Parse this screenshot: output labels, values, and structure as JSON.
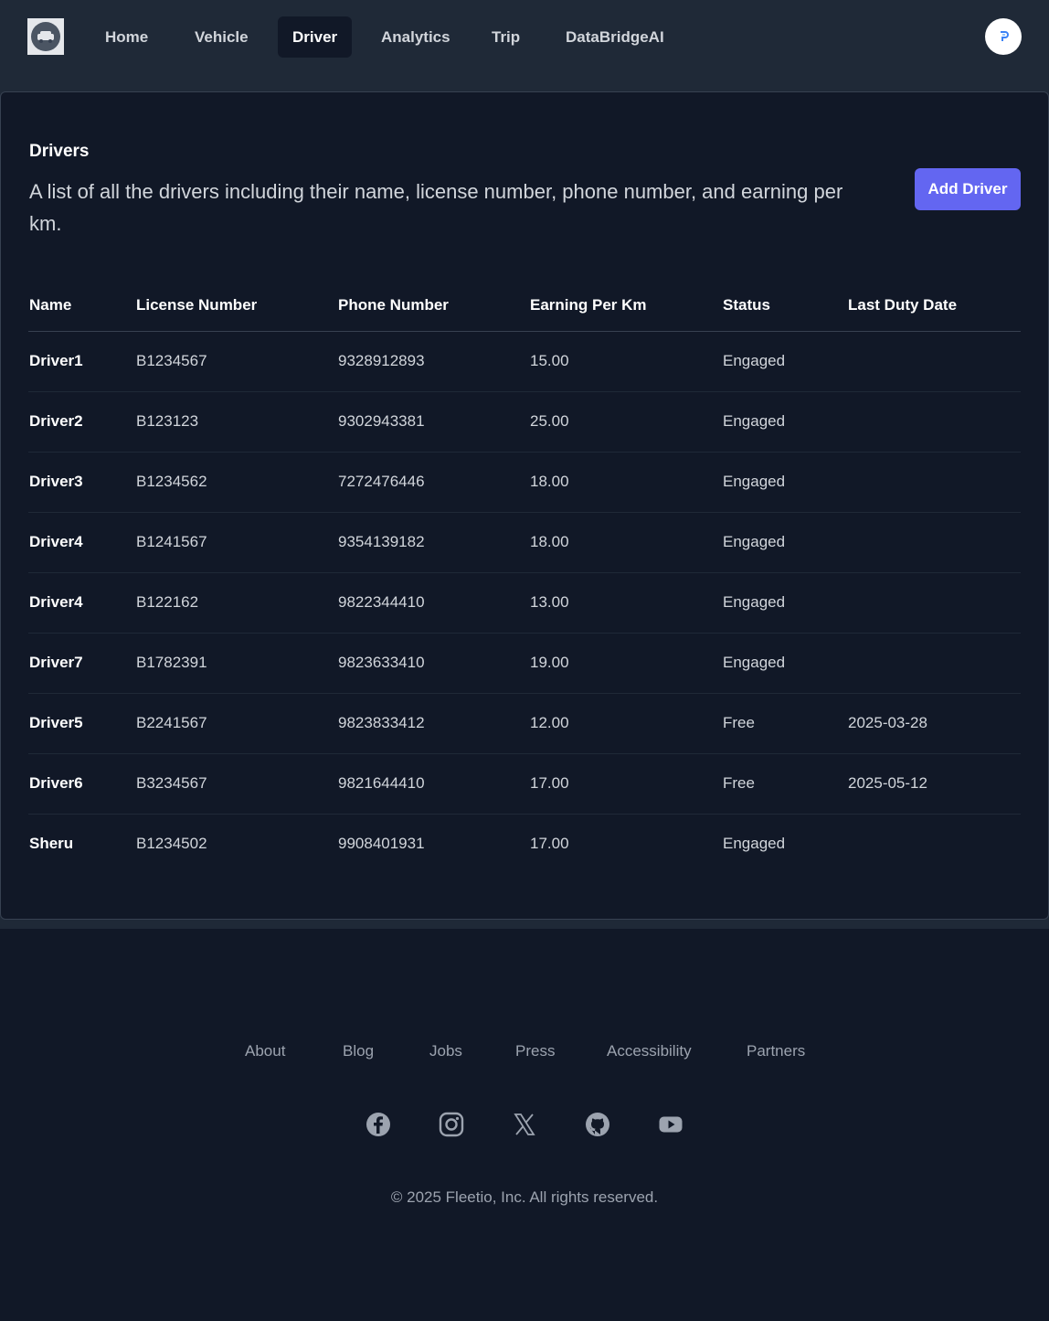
{
  "nav": {
    "items": [
      {
        "label": "Home",
        "active": false
      },
      {
        "label": "Vehicle",
        "active": false
      },
      {
        "label": "Driver",
        "active": true
      },
      {
        "label": "Analytics",
        "active": false
      },
      {
        "label": "Trip",
        "active": false
      },
      {
        "label": "DataBridgeAI",
        "active": false
      }
    ],
    "logo_icon": "car-logo-icon",
    "avatar_icon": "user-avatar-icon"
  },
  "drivers": {
    "title": "Drivers",
    "description": "A list of all the drivers including their name, license number, phone number, and earning per km.",
    "add_button_label": "Add Driver",
    "columns": [
      "Name",
      "License Number",
      "Phone Number",
      "Earning Per Km",
      "Status",
      "Last Duty Date"
    ],
    "rows": [
      {
        "name": "Driver1",
        "license": "B1234567",
        "phone": "9328912893",
        "earning": "15.00",
        "status": "Engaged",
        "last_duty": ""
      },
      {
        "name": "Driver2",
        "license": "B123123",
        "phone": "9302943381",
        "earning": "25.00",
        "status": "Engaged",
        "last_duty": ""
      },
      {
        "name": "Driver3",
        "license": "B1234562",
        "phone": "7272476446",
        "earning": "18.00",
        "status": "Engaged",
        "last_duty": ""
      },
      {
        "name": "Driver4",
        "license": "B1241567",
        "phone": "9354139182",
        "earning": "18.00",
        "status": "Engaged",
        "last_duty": ""
      },
      {
        "name": "Driver4",
        "license": "B122162",
        "phone": "9822344410",
        "earning": "13.00",
        "status": "Engaged",
        "last_duty": ""
      },
      {
        "name": "Driver7",
        "license": "B1782391",
        "phone": "9823633410",
        "earning": "19.00",
        "status": "Engaged",
        "last_duty": ""
      },
      {
        "name": "Driver5",
        "license": "B2241567",
        "phone": "9823833412",
        "earning": "12.00",
        "status": "Free",
        "last_duty": "2025-03-28"
      },
      {
        "name": "Driver6",
        "license": "B3234567",
        "phone": "9821644410",
        "earning": "17.00",
        "status": "Free",
        "last_duty": "2025-05-12"
      },
      {
        "name": "Sheru",
        "license": "B1234502",
        "phone": "9908401931",
        "earning": "17.00",
        "status": "Engaged",
        "last_duty": ""
      }
    ]
  },
  "footer": {
    "links": [
      "About",
      "Blog",
      "Jobs",
      "Press",
      "Accessibility",
      "Partners"
    ],
    "social_icons": [
      "facebook-icon",
      "instagram-icon",
      "x-icon",
      "github-icon",
      "youtube-icon"
    ],
    "copyright": "© 2025 Fleetio, Inc. All rights reserved."
  },
  "colors": {
    "background": "#111827",
    "header": "#1f2937",
    "accent": "#6366f1",
    "text_muted": "#9ca3af"
  }
}
